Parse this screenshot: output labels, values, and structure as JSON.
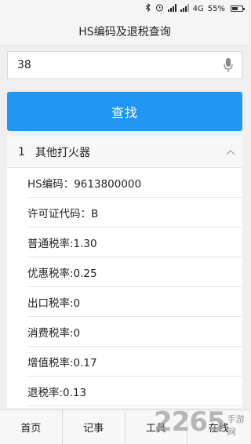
{
  "status_bar": {
    "icons": [
      "bluetooth-icon",
      "alarm-icon",
      "signal-icon",
      "signal-icon",
      "network-4g-icon"
    ],
    "network": "4G",
    "battery": "55%",
    "battery_level": 0.55
  },
  "header": {
    "title": "HS编码及退税查询"
  },
  "search": {
    "value": "38",
    "placeholder": ""
  },
  "find_button": {
    "label": "查找",
    "color": "#2196f3"
  },
  "result": {
    "index": "1",
    "name": "其他打火器",
    "details": [
      "HS编码：9613800000",
      "许可证代码：B",
      "普通税率:1.30",
      "优惠税率:0.25",
      "出口税率:0",
      "消费税率:0",
      "增值税率:0.17",
      "退税率:0.13"
    ]
  },
  "bottom_nav": {
    "items": [
      "首页",
      "记事",
      "工具",
      "在线"
    ]
  },
  "watermark": {
    "number": "2265",
    "text": "手游网"
  }
}
